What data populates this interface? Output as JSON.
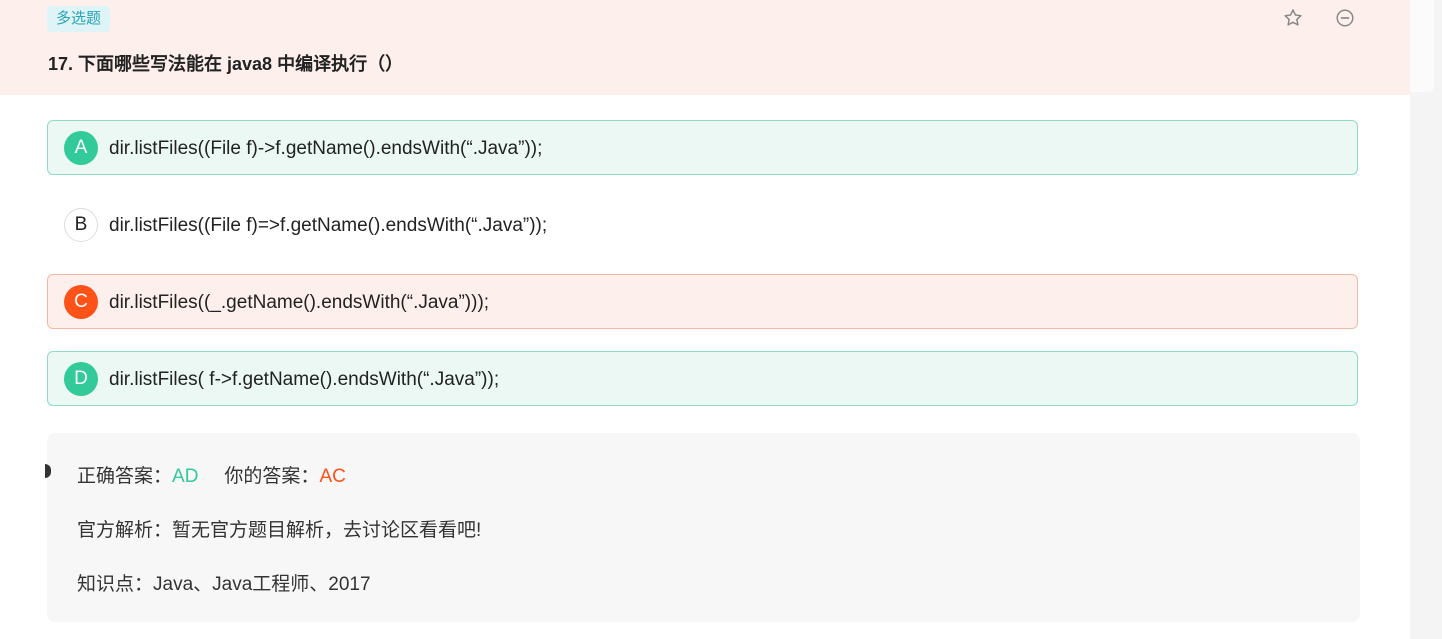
{
  "question": {
    "type_tag": "多选题",
    "title": "17. 下面哪些写法能在 java8 中编译执行（）"
  },
  "toolbar": {
    "favorite_icon": "star-outline-icon",
    "collapse_icon": "minus-circle-icon"
  },
  "options": [
    {
      "letter": "A",
      "text": "dir.listFiles((File f)->f.getName().endsWith(“.Java”));",
      "state": "correct"
    },
    {
      "letter": "B",
      "text": "dir.listFiles((File f)=>f.getName().endsWith(“.Java”));",
      "state": "neutral"
    },
    {
      "letter": "C",
      "text": "dir.listFiles((_.getName().endsWith(“.Java”)));",
      "state": "wrong"
    },
    {
      "letter": "D",
      "text": "dir.listFiles( f->f.getName().endsWith(“.Java”));",
      "state": "correct"
    }
  ],
  "analysis": {
    "correct_label": "正确答案：",
    "correct_value": "AD",
    "your_label": "你的答案：",
    "your_value": "AC",
    "official_label": "官方解析：",
    "official_text": "暂无官方题目解析，去讨论区看看吧!",
    "knowledge_label": "知识点：",
    "knowledge_text": "Java、Java工程师、2017"
  },
  "colors": {
    "correct": "#32ca99",
    "wrong": "#fe5218",
    "header_bg": "#fdf0ec",
    "tag_bg": "#dff4f7"
  }
}
